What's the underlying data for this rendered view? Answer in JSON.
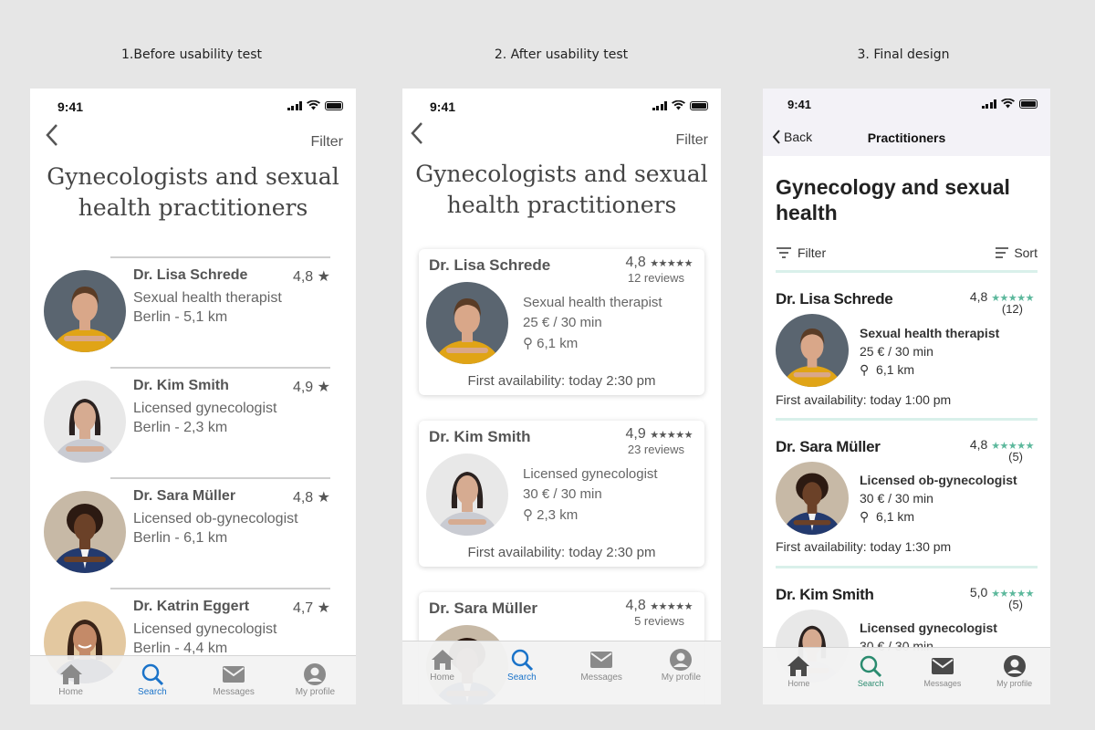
{
  "captions": [
    "1.Before usability test",
    "2. After usability test",
    "3. Final design"
  ],
  "status_time": "9:41",
  "colors": {
    "active_tab_blue": "#1a73c9",
    "active_tab_green": "#2a8b6f",
    "star_green": "#5cb89c",
    "mint_divider": "#d9f0ea"
  },
  "phone1": {
    "filter": "Filter",
    "title_line1": "Gynecologists and sexual",
    "title_line2": "health practitioners",
    "items": [
      {
        "name": "Dr. Lisa Schrede",
        "rating": "4,8",
        "line1": "Sexual health therapist",
        "line2": "Berlin - 5,1 km"
      },
      {
        "name": "Dr. Kim Smith",
        "rating": "4,9",
        "line1": "Licensed gynecologist",
        "line2": "Berlin - 2,3 km"
      },
      {
        "name": "Dr. Sara Müller",
        "rating": "4,8",
        "line1": "Licensed ob-gynecologist",
        "line2": "Berlin - 6,1 km"
      },
      {
        "name": "Dr. Katrin Eggert",
        "rating": "4,7",
        "line1": "Licensed gynecologist",
        "line2": "Berlin - 4,4 km"
      }
    ]
  },
  "phone2": {
    "filter": "Filter",
    "title_line1": "Gynecologists and sexual",
    "title_line2": "health practitioners",
    "cards": [
      {
        "name": "Dr. Lisa Schrede",
        "rating": "4,8",
        "reviews": "12 reviews",
        "specialty": "Sexual health therapist",
        "price": "25 € / 30 min",
        "distance": "6,1 km",
        "availability": "First availability: today 2:30 pm"
      },
      {
        "name": "Dr. Kim Smith",
        "rating": "4,9",
        "reviews": "23 reviews",
        "specialty": "Licensed gynecologist",
        "price": "30 € / 30 min",
        "distance": "2,3 km",
        "availability": "First availability: today 2:30 pm"
      },
      {
        "name": "Dr. Sara Müller",
        "rating": "4,8",
        "reviews": "5 reviews"
      }
    ]
  },
  "phone3": {
    "back": "Back",
    "nav_title": "Practitioners",
    "title": "Gynecology and sexual health",
    "filter": "Filter",
    "sort": "Sort",
    "items": [
      {
        "name": "Dr. Lisa Schrede",
        "rating": "4,8",
        "count": "(12)",
        "specialty": "Sexual health therapist",
        "price": "25 € / 30 min",
        "distance": "6,1 km",
        "availability": "First availability: today 1:00 pm"
      },
      {
        "name": "Dr. Sara Müller",
        "rating": "4,8",
        "count": "(5)",
        "specialty": "Licensed ob-gynecologist",
        "price": "30 € / 30 min",
        "distance": "6,1 km",
        "availability": "First availability: today 1:30 pm"
      },
      {
        "name": "Dr. Kim Smith",
        "rating": "5,0",
        "count": "(5)",
        "specialty": "Licensed gynecologist",
        "price": "30 € / 30 min"
      }
    ]
  },
  "tabs": [
    {
      "label": "Home",
      "icon": "home-icon"
    },
    {
      "label": "Search",
      "icon": "search-icon"
    },
    {
      "label": "Messages",
      "icon": "mail-icon"
    },
    {
      "label": "My profile",
      "icon": "profile-icon"
    }
  ]
}
